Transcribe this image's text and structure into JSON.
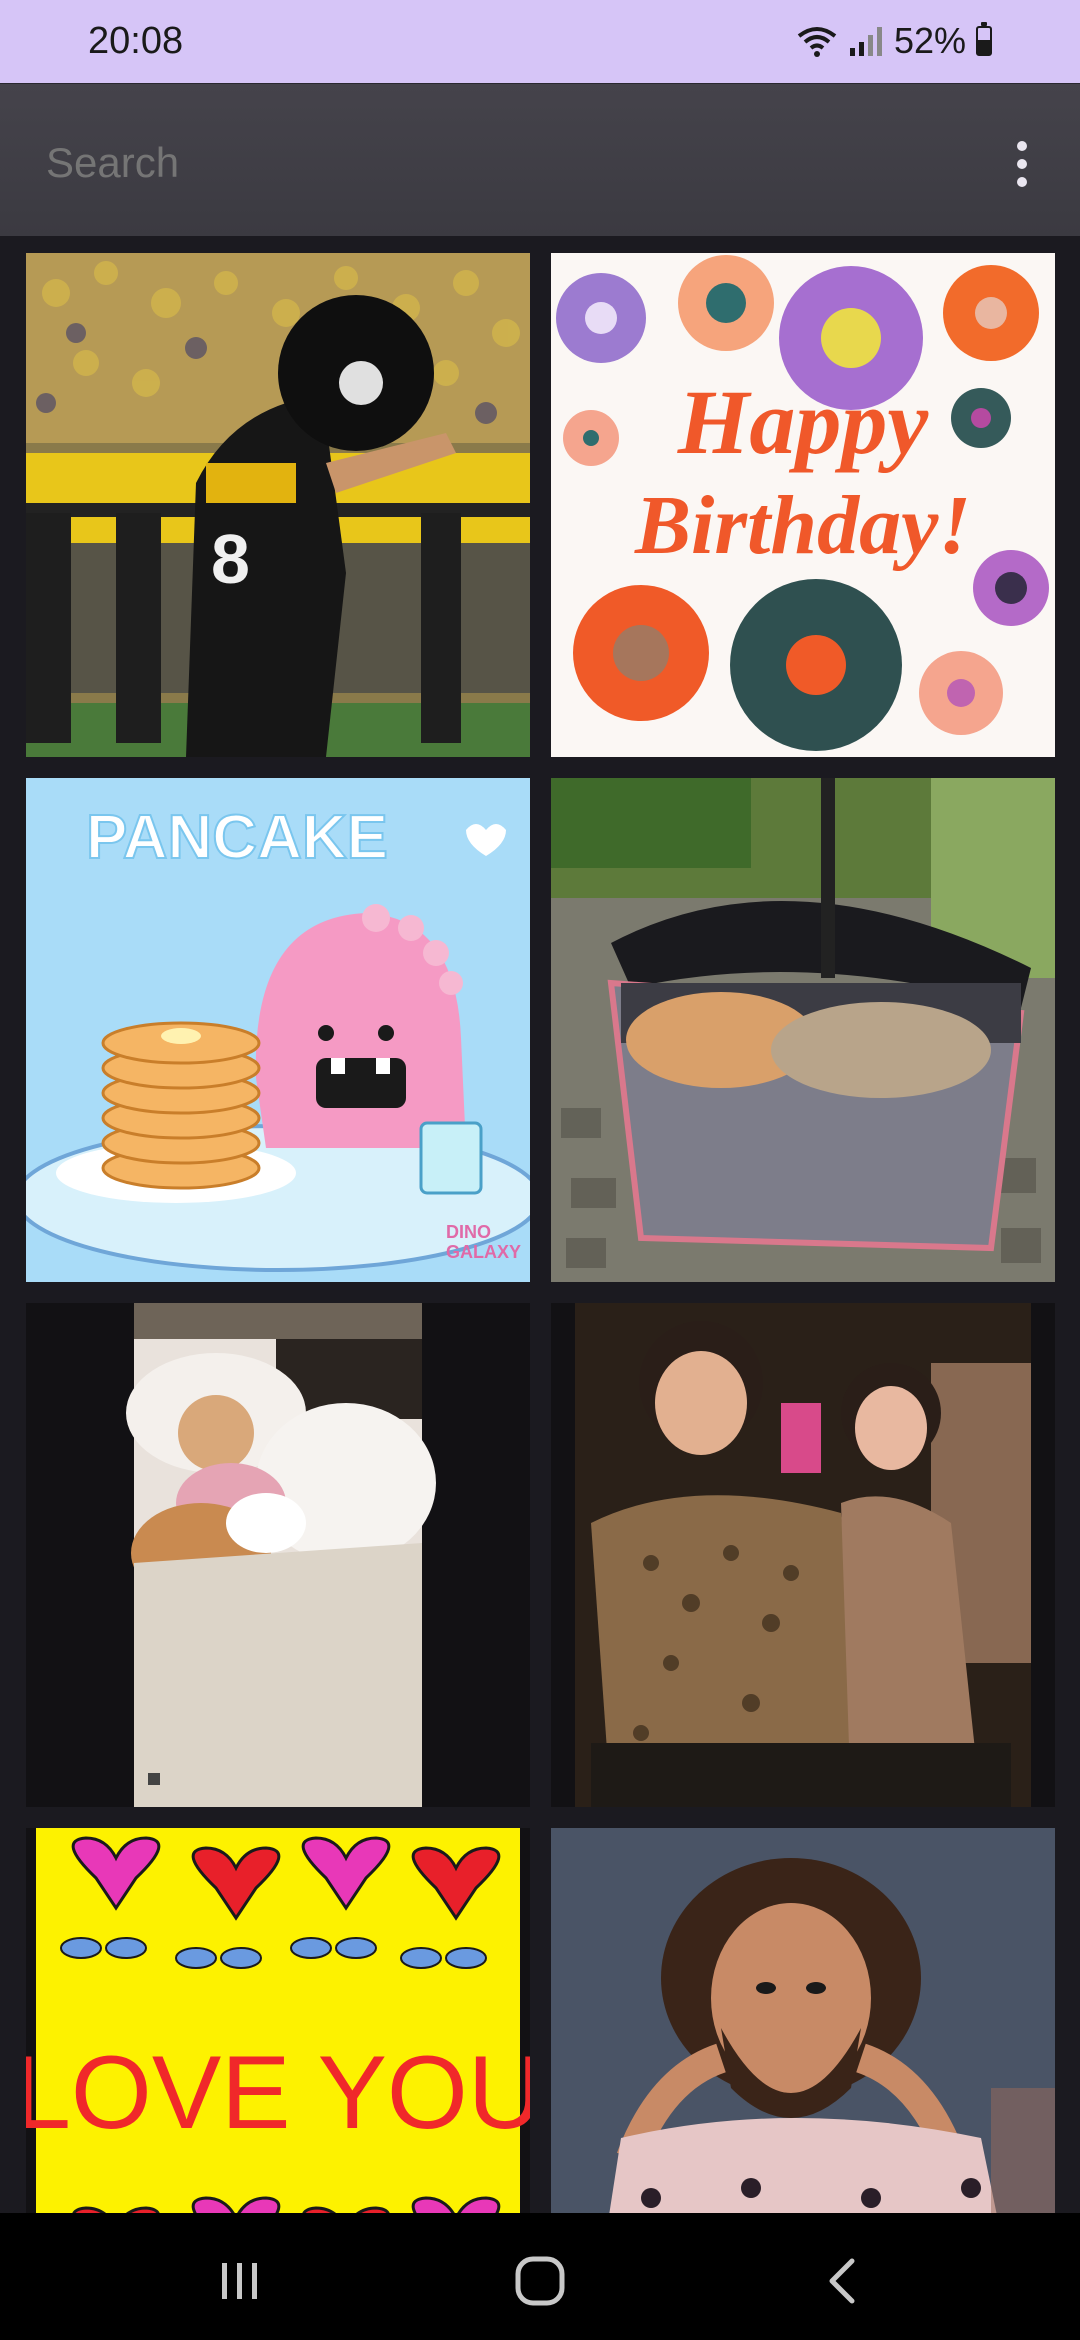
{
  "status_bar": {
    "time": "20:08",
    "battery_percent_text": "52%",
    "battery_level": 0.52,
    "icons": [
      "wifi-icon",
      "signal-icon",
      "battery-icon"
    ]
  },
  "search": {
    "placeholder": "Search",
    "menu_icon": "more-vert-icon"
  },
  "gifs": [
    {
      "name": "gif-football-player",
      "description_icon": "photo"
    },
    {
      "name": "gif-happy-birthday",
      "text": "Happy Birthday!"
    },
    {
      "name": "gif-pancake",
      "text": "PANCAKE",
      "watermark": "DINO GALAXY"
    },
    {
      "name": "gif-cats-stroller"
    },
    {
      "name": "gif-girl-dog-bed"
    },
    {
      "name": "gif-dancing-women"
    },
    {
      "name": "gif-love-you",
      "text": "LOVE YOU"
    },
    {
      "name": "gif-man-beard"
    }
  ],
  "nav": {
    "recents_icon": "recents-icon",
    "home_icon": "home-icon",
    "back_icon": "back-icon"
  },
  "colors": {
    "status_bar_bg": "#d6c5f7",
    "app_bar_bg": "#3f3e45",
    "page_bg": "#1b1a20"
  }
}
